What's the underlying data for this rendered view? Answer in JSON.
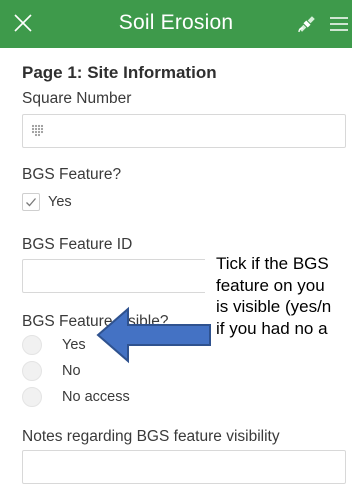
{
  "header": {
    "title": "Soil Erosion",
    "close_icon": "close-icon",
    "gps_icon": "satellite-icon",
    "menu_icon": "hamburger-menu-icon",
    "color": "#3e9a4b"
  },
  "page": {
    "title": "Page 1: Site Information"
  },
  "fields": {
    "square_number": {
      "label": "Square Number",
      "value": "",
      "icon": "keypad-icon"
    },
    "bgs_feature": {
      "label": "BGS Feature?",
      "option_label": "Yes",
      "checked": true
    },
    "bgs_feature_id": {
      "label": "BGS Feature ID",
      "value": "",
      "icon": "chevron-down-icon"
    },
    "bgs_visible": {
      "label": "BGS Feature visible?",
      "options": [
        "Yes",
        "No",
        "No access"
      ]
    },
    "notes": {
      "label": "Notes regarding BGS feature visibility",
      "value": ""
    }
  },
  "annotation": {
    "lines": [
      "Tick if the BGS",
      "feature on you",
      "is visible (yes/n",
      "if you had no a"
    ],
    "arrow_color": "#4472c4"
  }
}
